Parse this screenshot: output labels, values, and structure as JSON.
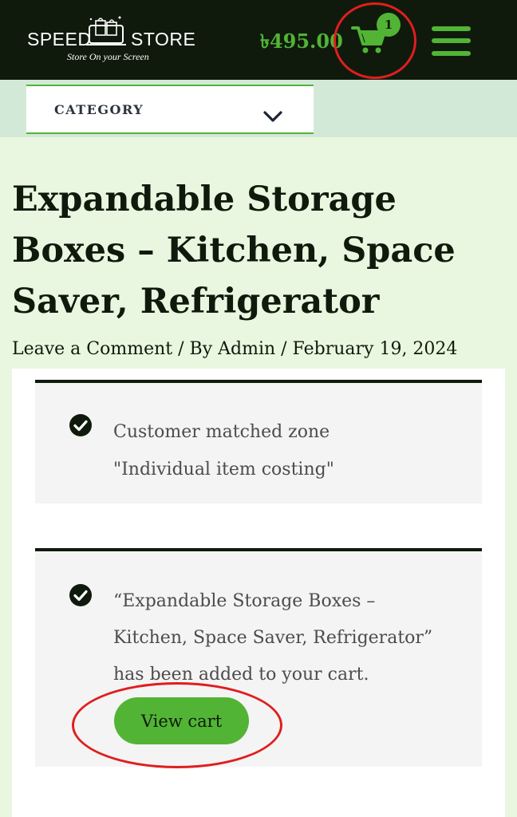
{
  "header": {
    "logo_word_1": "SPEED",
    "logo_word_2": "STORE",
    "logo_tagline": "Store On your Screen",
    "cart_total": "৳495.00",
    "cart_count": "1",
    "icons": {
      "cart": "shopping-cart-icon",
      "menu": "hamburger-menu-icon",
      "logo": "shopping-bags-logo"
    }
  },
  "category": {
    "label": "CATEGORY",
    "icon": "chevron-down-icon"
  },
  "post": {
    "title": "Expandable Storage Boxes – Kitchen, Space Saver, Refrigerator",
    "meta": "Leave a Comment / By Admin / February 19, 2024"
  },
  "notices": [
    {
      "line1": "Customer matched zone",
      "line2": "\"Individual item costing\"",
      "icon": "check-circle-icon"
    },
    {
      "line1": "“Expandable Storage Boxes –",
      "line2": "Kitchen, Space Saver, Refrigerator”",
      "line3": "has been added to your cart.",
      "button_label": "View cart",
      "icon": "check-circle-icon"
    }
  ],
  "colors": {
    "header_bg": "#0f1a0c",
    "accent_green": "#51b435",
    "page_bg": "#eaf7e0",
    "category_band": "#d3e9d8",
    "notice_bg": "#f4f4f4",
    "annotation_red": "#e01e1e"
  }
}
